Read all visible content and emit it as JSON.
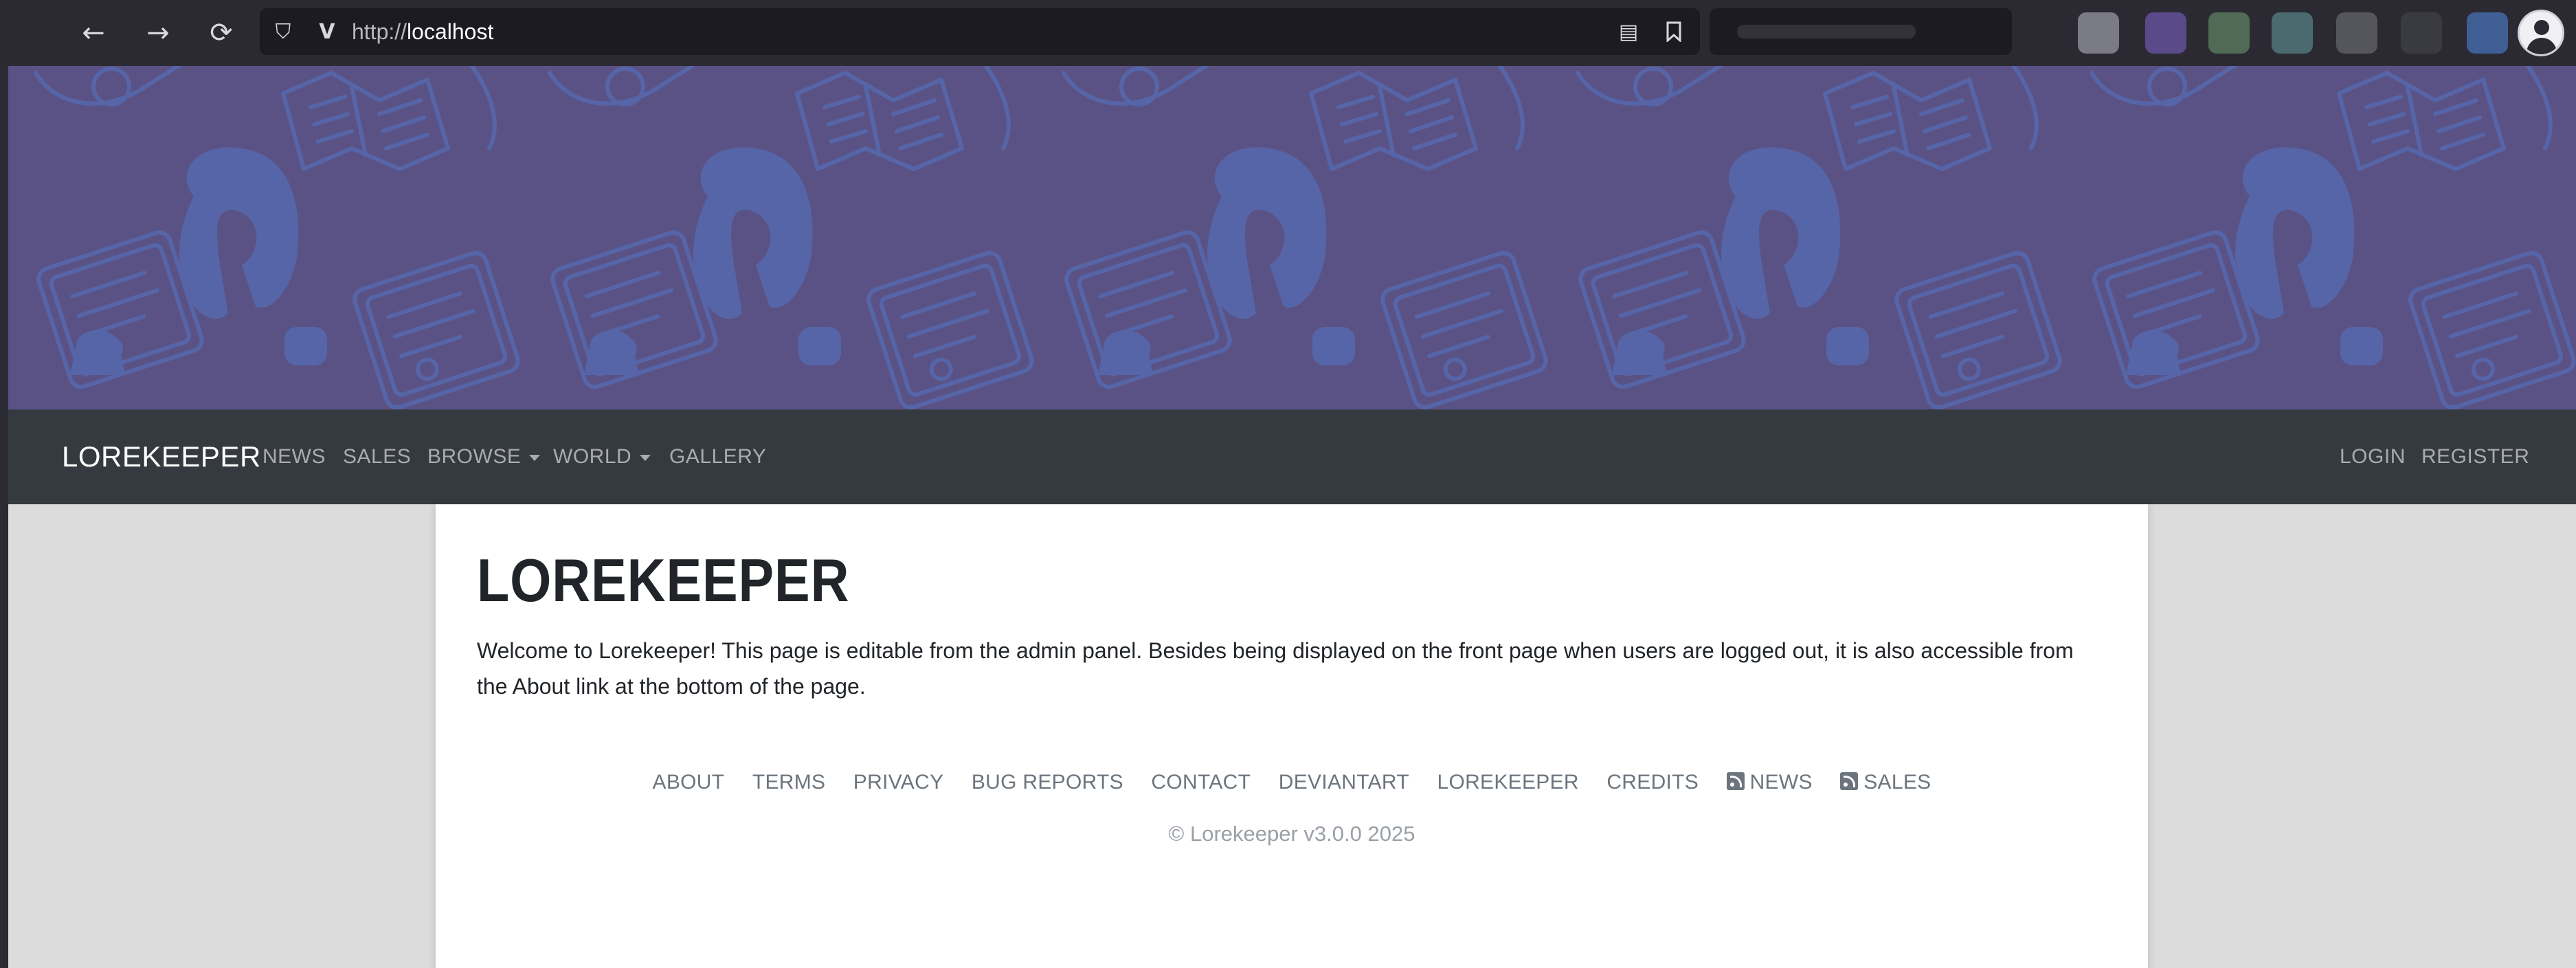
{
  "browser": {
    "url_protocol": "http://",
    "url_host": "localhost",
    "back_glyph": "←",
    "forward_glyph": "→",
    "reload_glyph": "⟳",
    "shield_glyph": "⛉",
    "site_glyph": "V",
    "reader_glyph": "▤",
    "bookmark_glyph": "🔖"
  },
  "navbar": {
    "brand": "LOREKEEPER",
    "items": [
      "NEWS",
      "SALES",
      "BROWSE",
      "WORLD",
      "GALLERY"
    ],
    "right_items": [
      "LOGIN",
      "REGISTER"
    ]
  },
  "content": {
    "title": "LOREKEEPER",
    "body": "Welcome to Lorekeeper! This page is editable from the admin panel. Besides being displayed on the front page when users are logged out, it is also accessible from the About link at the bottom of the page."
  },
  "footer": {
    "links": [
      "ABOUT",
      "TERMS",
      "PRIVACY",
      "BUG REPORTS",
      "CONTACT",
      "DEVIANTART",
      "LOREKEEPER",
      "CREDITS",
      "NEWS",
      "SALES"
    ],
    "copyright": "© Lorekeeper v3.0.0 2025"
  },
  "colors": {
    "banner": "#5a5285",
    "banner_pattern": "#5665a8",
    "navbar": "#343a40",
    "page_bg": "#dcdcdc"
  }
}
